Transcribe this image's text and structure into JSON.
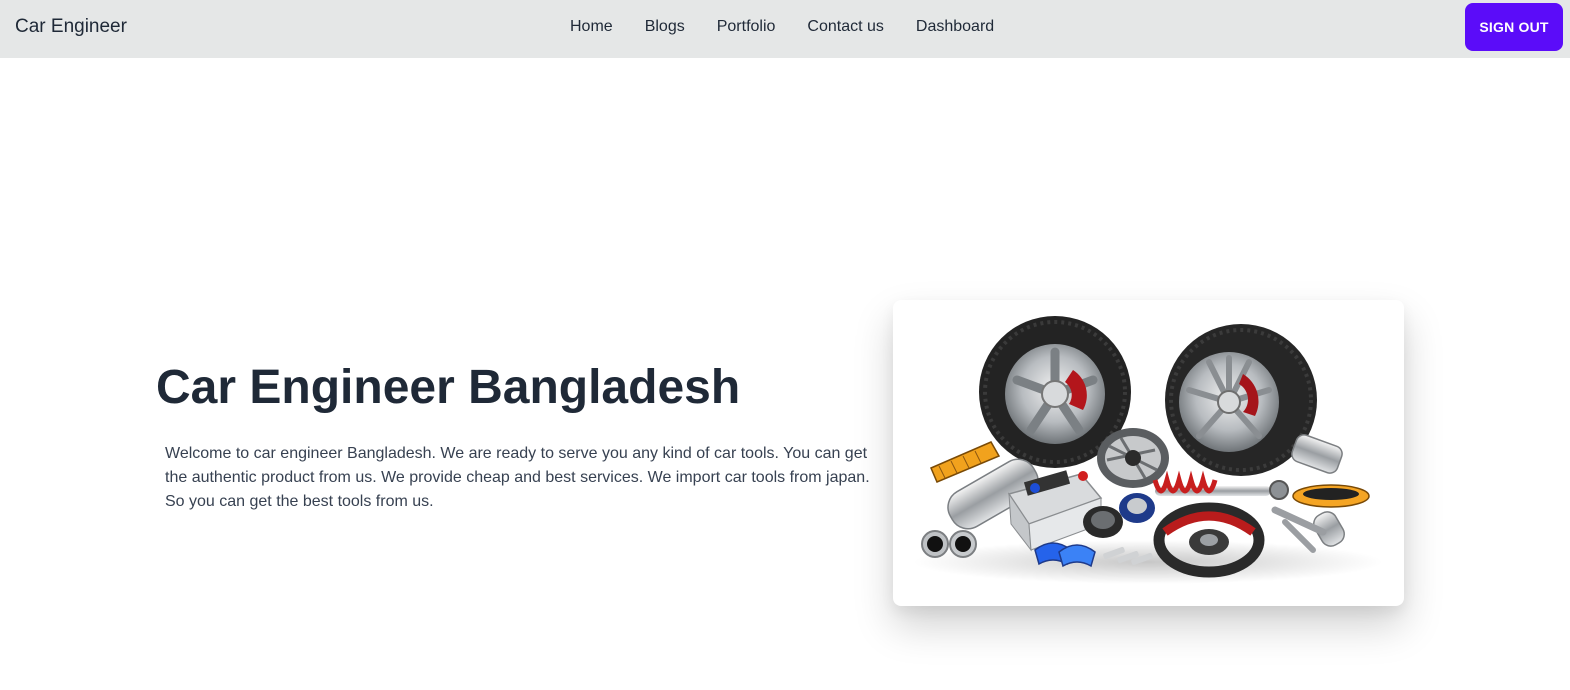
{
  "navbar": {
    "brand": "Car Engineer",
    "links": [
      {
        "label": "Home"
      },
      {
        "label": "Blogs"
      },
      {
        "label": "Portfolio"
      },
      {
        "label": "Contact us"
      },
      {
        "label": "Dashboard"
      }
    ],
    "sign_out_label": "SIGN OUT"
  },
  "hero": {
    "title": "Car Engineer Bangladesh",
    "description": "Welcome to car engineer Bangladesh. We are ready to serve you any kind of car tools. You can get the authentic product from us. We provide cheap and best services. We import car tools from japan. So you can get the best tools from us.",
    "image_icon": "car-parts-image"
  },
  "colors": {
    "navbar_bg": "#e5e7e7",
    "accent": "#5b0cf9",
    "text": "#1f2937"
  }
}
